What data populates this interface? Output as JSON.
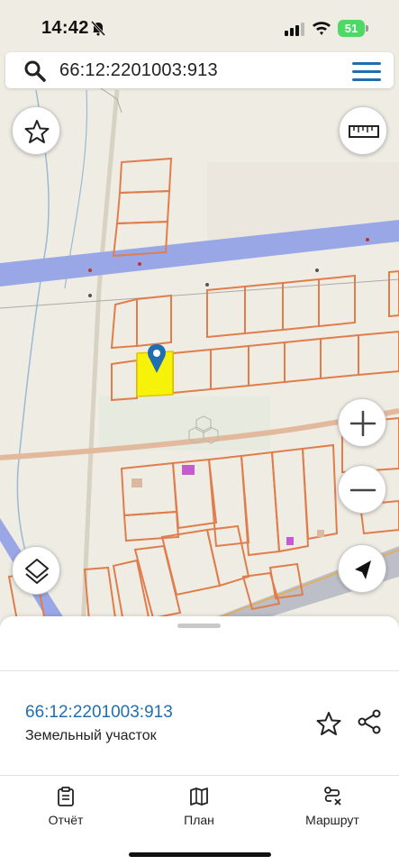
{
  "status_bar": {
    "time": "14:42",
    "battery": "51",
    "icons": [
      "bell-off-icon",
      "signal-icon",
      "wifi-icon",
      "battery-icon"
    ]
  },
  "search": {
    "value": "66:12:2201003:913",
    "icons": [
      "search-icon",
      "menu-icon"
    ]
  },
  "map": {
    "parcel_highlight_color": "#f7f20a",
    "parcel_border_color": "#e07d4c",
    "road_color": "#9aa7e6",
    "marker_color": "#1f6eb0",
    "buttons": [
      "favorite-icon",
      "ruler-icon",
      "zoom-in-icon",
      "zoom-out-icon",
      "layers-icon",
      "navigation-arrow-icon"
    ]
  },
  "sheet": {
    "parcel_number": "66:12:2201003:913",
    "parcel_type": "Земельный участок",
    "actions": [
      "star-icon",
      "share-icon"
    ]
  },
  "tabbar": {
    "tabs": [
      {
        "label": "Отчёт",
        "icon": "clipboard-icon"
      },
      {
        "label": "План",
        "icon": "map-icon"
      },
      {
        "label": "Маршрут",
        "icon": "route-icon"
      }
    ]
  },
  "colors": {
    "accent": "#1f6eb0",
    "menu": "#1f6eb0"
  }
}
